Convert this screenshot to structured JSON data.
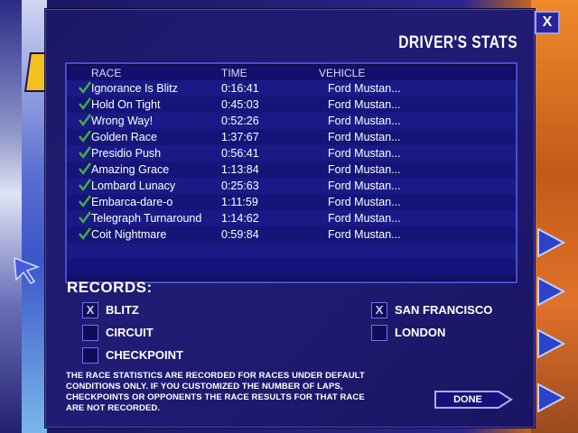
{
  "dialog": {
    "title": "DRIVER'S STATS",
    "close_label": "X"
  },
  "table": {
    "headers": {
      "race": "RACE",
      "time": "TIME",
      "vehicle": "VEHICLE"
    },
    "rows": [
      {
        "race": "Ignorance Is Blitz",
        "time": "0:16:41",
        "vehicle": "Ford Mustan..."
      },
      {
        "race": "Hold On Tight",
        "time": "0:45:03",
        "vehicle": "Ford Mustan..."
      },
      {
        "race": "Wrong Way!",
        "time": "0:52:26",
        "vehicle": "Ford Mustan..."
      },
      {
        "race": "Golden Race",
        "time": "1:37:67",
        "vehicle": "Ford Mustan..."
      },
      {
        "race": "Presidio Push",
        "time": "0:56:41",
        "vehicle": "Ford Mustan..."
      },
      {
        "race": "Amazing Grace",
        "time": "1:13:84",
        "vehicle": "Ford Mustan..."
      },
      {
        "race": "Lombard Lunacy",
        "time": "0:25:63",
        "vehicle": "Ford Mustan..."
      },
      {
        "race": "Embarca-dare-o",
        "time": "1:11:59",
        "vehicle": "Ford Mustan..."
      },
      {
        "race": "Telegraph Turnaround",
        "time": "1:14:62",
        "vehicle": "Ford Mustan..."
      },
      {
        "race": "Coit Nightmare",
        "time": "0:59:84",
        "vehicle": "Ford Mustan..."
      }
    ]
  },
  "records": {
    "title": "RECORDS:",
    "modes": [
      {
        "label": "BLITZ",
        "checked": true,
        "mark": "X"
      },
      {
        "label": "CIRCUIT",
        "checked": false,
        "mark": ""
      },
      {
        "label": "CHECKPOINT",
        "checked": false,
        "mark": ""
      }
    ],
    "cities": [
      {
        "label": "SAN FRANCISCO",
        "checked": true,
        "mark": "X"
      },
      {
        "label": "LONDON",
        "checked": false,
        "mark": ""
      }
    ]
  },
  "note": "THE RACE STATISTICS ARE RECORDED FOR RACES UNDER DEFAULT CONDITIONS ONLY.  IF YOU CUSTOMIZED THE NUMBER OF LAPS, CHECKPOINTS OR OPPONENTS THE RACE RESULTS FOR THAT RACE ARE NOT RECORDED.",
  "done_label": "DONE",
  "icons": {
    "row_status": "checkmark-icon",
    "nav": "arrow-icon"
  },
  "colors": {
    "dialog_bg": "#1c1868",
    "check": "#3fae46",
    "accent": "#9aa0ff"
  }
}
